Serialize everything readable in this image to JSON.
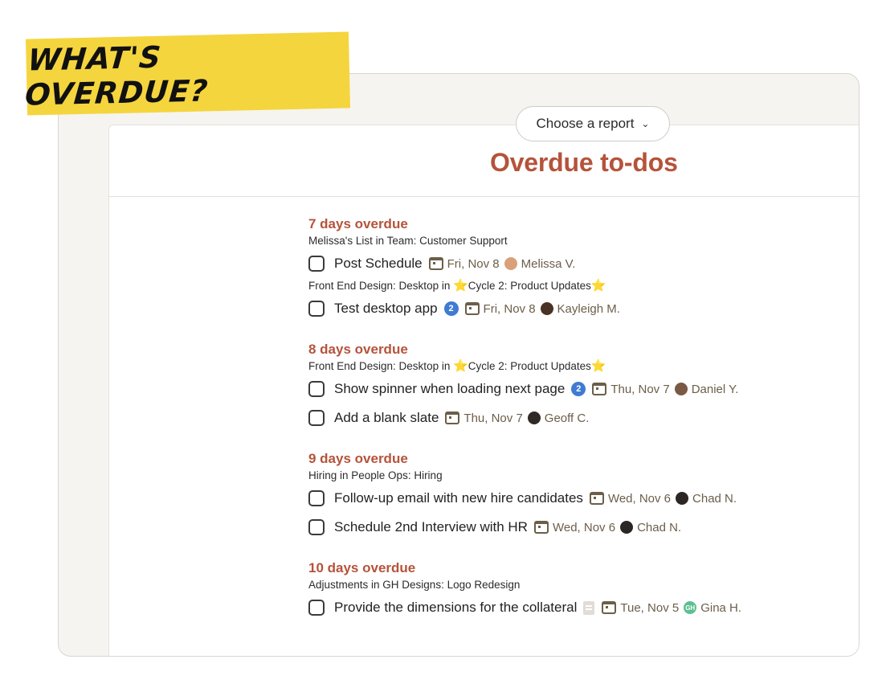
{
  "banner": {
    "text": "WHAT'S OVERDUE?"
  },
  "report_chooser": {
    "label": "Choose a report",
    "icon": "chevron-down-icon"
  },
  "report": {
    "title": "Overdue to-dos"
  },
  "groups": [
    {
      "title": "7 days overdue",
      "sections": [
        {
          "context": "Melissa's List in Team: Customer Support",
          "todos": [
            {
              "title": "Post Schedule",
              "due": "Fri, Nov 8",
              "assignee": "Melissa V.",
              "avatar_color": "#d9a079"
            }
          ]
        },
        {
          "context_prefix": "Front End Design: Desktop in ",
          "context_project": "Cycle 2: Product Updates",
          "todos": [
            {
              "title": "Test desktop app",
              "comments": "2",
              "due": "Fri, Nov 8",
              "assignee": "Kayleigh M.",
              "avatar_color": "#4a3226"
            }
          ]
        }
      ]
    },
    {
      "title": "8 days overdue",
      "sections": [
        {
          "context_prefix": "Front End Design: Desktop in ",
          "context_project": "Cycle 2: Product Updates",
          "todos": [
            {
              "title": "Show spinner when loading next page",
              "comments": "2",
              "due": "Thu, Nov 7",
              "assignee": "Daniel Y.",
              "avatar_color": "#7a5a44"
            },
            {
              "title": "Add a blank slate",
              "due": "Thu, Nov 7",
              "assignee": "Geoff C.",
              "avatar_color": "#2f2a26"
            }
          ]
        }
      ]
    },
    {
      "title": "9 days overdue",
      "sections": [
        {
          "context": "Hiring in People Ops: Hiring",
          "todos": [
            {
              "title": "Follow-up email with new hire candidates",
              "due": "Wed, Nov 6",
              "assignee": "Chad N.",
              "avatar_color": "#2b2623"
            },
            {
              "title": "Schedule 2nd Interview with HR",
              "due": "Wed, Nov 6",
              "assignee": "Chad N.",
              "avatar_color": "#2b2623"
            }
          ]
        }
      ]
    },
    {
      "title": "10 days overdue",
      "sections": [
        {
          "context": "Adjustments in GH Designs: Logo Redesign",
          "todos": [
            {
              "title": "Provide the dimensions for the collateral",
              "has_note": true,
              "due": "Tue, Nov 5",
              "assignee": "Gina H.",
              "avatar_initials": "GH",
              "avatar_color": "#5fbf8f"
            }
          ]
        }
      ]
    }
  ],
  "colors": {
    "accent": "#b5533a",
    "banner": "#f5d53e",
    "meta": "#6c5e49",
    "badge": "#3f7bd1"
  }
}
